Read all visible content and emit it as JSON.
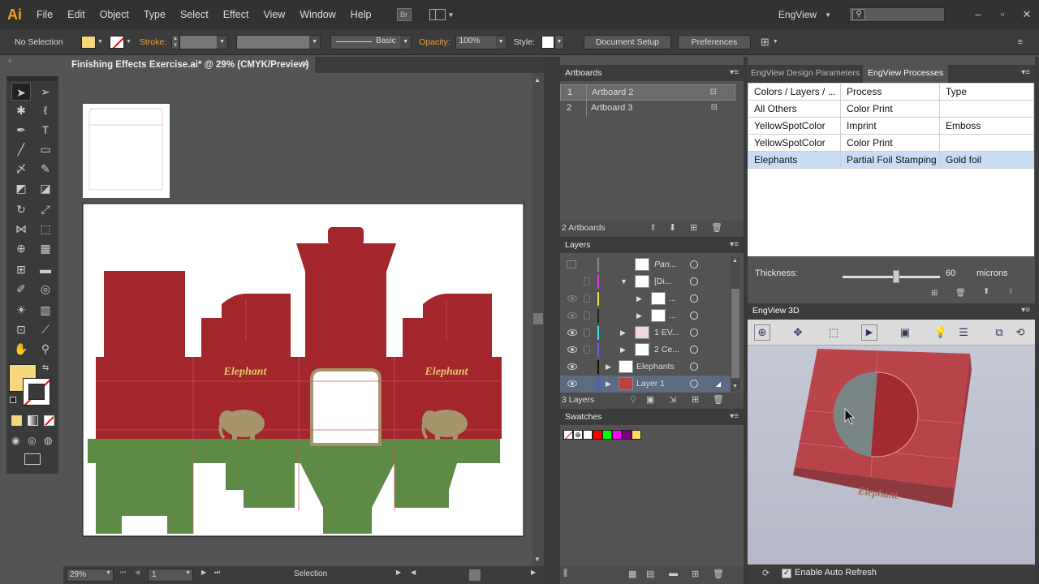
{
  "menubar": {
    "logo": "Ai",
    "items": [
      "File",
      "Edit",
      "Object",
      "Type",
      "Select",
      "Effect",
      "View",
      "Window",
      "Help"
    ],
    "bridge_label": "Br",
    "workspace": "EngView",
    "search_placeholder": ""
  },
  "control_bar": {
    "selection_status": "No Selection",
    "stroke_label": "Stroke:",
    "stroke_profile": "Basic",
    "opacity_label": "Opacity:",
    "opacity_value": "100%",
    "style_label": "Style:",
    "document_setup": "Document Setup",
    "preferences": "Preferences"
  },
  "document": {
    "tab_title": "Finishing Effects Exercise.ai* @ 29% (CMYK/Preview)",
    "artwork_text_1": "Elephant",
    "artwork_text_2": "Elephant"
  },
  "status_bar": {
    "zoom": "29%",
    "artboard_number": "1",
    "tool_name": "Selection"
  },
  "artboards_panel": {
    "title": "Artboards",
    "items": [
      {
        "num": "1",
        "name": "Artboard 2"
      },
      {
        "num": "2",
        "name": "Artboard 3"
      }
    ],
    "footer": "2 Artboards"
  },
  "layers_panel": {
    "title": "Layers",
    "items": [
      {
        "name": "Pan...",
        "color": "#8a8a8a"
      },
      {
        "name": "[Di...",
        "color": "#e040e0"
      },
      {
        "name": "...",
        "color": "#f0e040"
      },
      {
        "name": "...",
        "color": "#222222"
      },
      {
        "name": "1 EV...",
        "color": "#40e0f0"
      },
      {
        "name": "2 Ce...",
        "color": "#6060f0"
      },
      {
        "name": "Elephants",
        "color": "#111111"
      },
      {
        "name": "Layer 1",
        "color": "#4060e0"
      }
    ],
    "footer": "3 Layers"
  },
  "swatches_panel": {
    "title": "Swatches",
    "colors": [
      "#ffffff",
      "#ffffff",
      "#ff0000",
      "#00ff00",
      "#ff00ff",
      "#800080",
      "#ffd966"
    ]
  },
  "engview_tabs": {
    "design_parameters": "EngView Design Parameters",
    "processes": "EngView Processes"
  },
  "processes_table": {
    "headers": [
      "Colors / Layers / ...",
      "Process",
      "Type"
    ],
    "rows": [
      [
        "All Others",
        "Color Print",
        ""
      ],
      [
        "YellowSpotColor",
        "Imprint",
        "Emboss"
      ],
      [
        "YellowSpotColor",
        "Color Print",
        ""
      ],
      [
        "Elephants",
        "Partial Foil Stamping",
        "Gold foil"
      ]
    ]
  },
  "thickness": {
    "label": "Thickness:",
    "value": "60",
    "unit": "microns",
    "slider_fraction": 0.55
  },
  "engview3d": {
    "title": "EngView 3D",
    "auto_refresh_label": "Enable Auto Refresh",
    "box_text": "Elephant"
  },
  "colors": {
    "box_red": "#a2262c",
    "box_green": "#5d8a45",
    "elephant_tan": "#a8946a",
    "text_gold": "#e3c56a",
    "fill_swatch": "#f7d77b",
    "selection_blue": "#c8ddf5"
  }
}
